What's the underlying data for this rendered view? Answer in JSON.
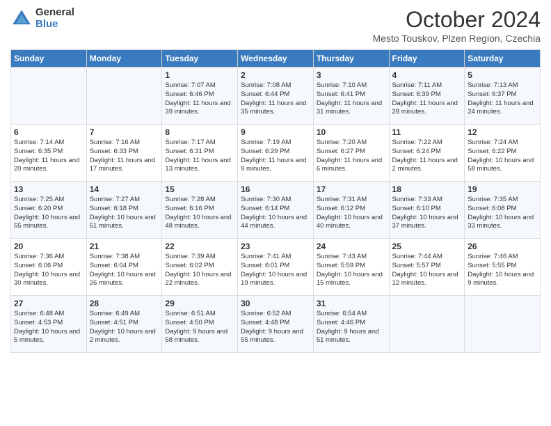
{
  "logo": {
    "general": "General",
    "blue": "Blue"
  },
  "header": {
    "month": "October 2024",
    "location": "Mesto Touskov, Plzen Region, Czechia"
  },
  "weekdays": [
    "Sunday",
    "Monday",
    "Tuesday",
    "Wednesday",
    "Thursday",
    "Friday",
    "Saturday"
  ],
  "weeks": [
    [
      {
        "day": "",
        "content": ""
      },
      {
        "day": "",
        "content": ""
      },
      {
        "day": "1",
        "content": "Sunrise: 7:07 AM\nSunset: 6:46 PM\nDaylight: 11 hours and 39 minutes."
      },
      {
        "day": "2",
        "content": "Sunrise: 7:08 AM\nSunset: 6:44 PM\nDaylight: 11 hours and 35 minutes."
      },
      {
        "day": "3",
        "content": "Sunrise: 7:10 AM\nSunset: 6:41 PM\nDaylight: 11 hours and 31 minutes."
      },
      {
        "day": "4",
        "content": "Sunrise: 7:11 AM\nSunset: 6:39 PM\nDaylight: 11 hours and 28 minutes."
      },
      {
        "day": "5",
        "content": "Sunrise: 7:13 AM\nSunset: 6:37 PM\nDaylight: 11 hours and 24 minutes."
      }
    ],
    [
      {
        "day": "6",
        "content": "Sunrise: 7:14 AM\nSunset: 6:35 PM\nDaylight: 11 hours and 20 minutes."
      },
      {
        "day": "7",
        "content": "Sunrise: 7:16 AM\nSunset: 6:33 PM\nDaylight: 11 hours and 17 minutes."
      },
      {
        "day": "8",
        "content": "Sunrise: 7:17 AM\nSunset: 6:31 PM\nDaylight: 11 hours and 13 minutes."
      },
      {
        "day": "9",
        "content": "Sunrise: 7:19 AM\nSunset: 6:29 PM\nDaylight: 11 hours and 9 minutes."
      },
      {
        "day": "10",
        "content": "Sunrise: 7:20 AM\nSunset: 6:27 PM\nDaylight: 11 hours and 6 minutes."
      },
      {
        "day": "11",
        "content": "Sunrise: 7:22 AM\nSunset: 6:24 PM\nDaylight: 11 hours and 2 minutes."
      },
      {
        "day": "12",
        "content": "Sunrise: 7:24 AM\nSunset: 6:22 PM\nDaylight: 10 hours and 58 minutes."
      }
    ],
    [
      {
        "day": "13",
        "content": "Sunrise: 7:25 AM\nSunset: 6:20 PM\nDaylight: 10 hours and 55 minutes."
      },
      {
        "day": "14",
        "content": "Sunrise: 7:27 AM\nSunset: 6:18 PM\nDaylight: 10 hours and 51 minutes."
      },
      {
        "day": "15",
        "content": "Sunrise: 7:28 AM\nSunset: 6:16 PM\nDaylight: 10 hours and 48 minutes."
      },
      {
        "day": "16",
        "content": "Sunrise: 7:30 AM\nSunset: 6:14 PM\nDaylight: 10 hours and 44 minutes."
      },
      {
        "day": "17",
        "content": "Sunrise: 7:31 AM\nSunset: 6:12 PM\nDaylight: 10 hours and 40 minutes."
      },
      {
        "day": "18",
        "content": "Sunrise: 7:33 AM\nSunset: 6:10 PM\nDaylight: 10 hours and 37 minutes."
      },
      {
        "day": "19",
        "content": "Sunrise: 7:35 AM\nSunset: 6:08 PM\nDaylight: 10 hours and 33 minutes."
      }
    ],
    [
      {
        "day": "20",
        "content": "Sunrise: 7:36 AM\nSunset: 6:06 PM\nDaylight: 10 hours and 30 minutes."
      },
      {
        "day": "21",
        "content": "Sunrise: 7:38 AM\nSunset: 6:04 PM\nDaylight: 10 hours and 26 minutes."
      },
      {
        "day": "22",
        "content": "Sunrise: 7:39 AM\nSunset: 6:02 PM\nDaylight: 10 hours and 22 minutes."
      },
      {
        "day": "23",
        "content": "Sunrise: 7:41 AM\nSunset: 6:01 PM\nDaylight: 10 hours and 19 minutes."
      },
      {
        "day": "24",
        "content": "Sunrise: 7:43 AM\nSunset: 5:59 PM\nDaylight: 10 hours and 15 minutes."
      },
      {
        "day": "25",
        "content": "Sunrise: 7:44 AM\nSunset: 5:57 PM\nDaylight: 10 hours and 12 minutes."
      },
      {
        "day": "26",
        "content": "Sunrise: 7:46 AM\nSunset: 5:55 PM\nDaylight: 10 hours and 9 minutes."
      }
    ],
    [
      {
        "day": "27",
        "content": "Sunrise: 6:48 AM\nSunset: 4:53 PM\nDaylight: 10 hours and 5 minutes."
      },
      {
        "day": "28",
        "content": "Sunrise: 6:49 AM\nSunset: 4:51 PM\nDaylight: 10 hours and 2 minutes."
      },
      {
        "day": "29",
        "content": "Sunrise: 6:51 AM\nSunset: 4:50 PM\nDaylight: 9 hours and 58 minutes."
      },
      {
        "day": "30",
        "content": "Sunrise: 6:52 AM\nSunset: 4:48 PM\nDaylight: 9 hours and 55 minutes."
      },
      {
        "day": "31",
        "content": "Sunrise: 6:54 AM\nSunset: 4:46 PM\nDaylight: 9 hours and 51 minutes."
      },
      {
        "day": "",
        "content": ""
      },
      {
        "day": "",
        "content": ""
      }
    ]
  ]
}
